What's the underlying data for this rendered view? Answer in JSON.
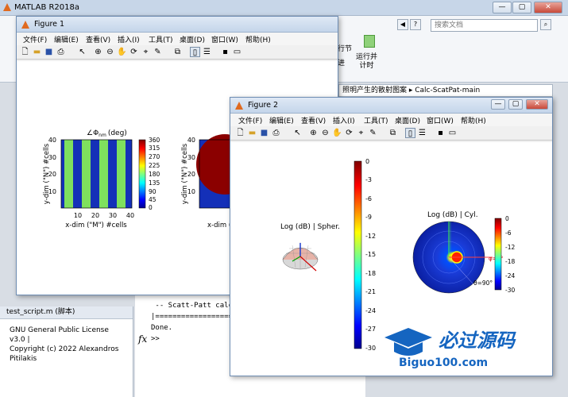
{
  "main_window": {
    "title": "MATLAB R2018a",
    "controls": [
      "—",
      "▢",
      "✕"
    ],
    "search_placeholder": "搜索文档",
    "ribbon_labels": [
      "行节",
      "运行并\n计时"
    ],
    "ribbon_fragment": "进",
    "address": "照明产生的散射图案 ▸ Calc-ScatPat-main"
  },
  "left_panel": {
    "file_tab": "test_script.m  (脚本)",
    "text_lines": [
      "GNU General Public License v3.0 |",
      "Copyright (c) 2022 Alexandros",
      "Pitilakis"
    ]
  },
  "command_window": {
    "lines": [
      " -- Scatt-Patt calc.",
      "|==========================",
      "Done."
    ],
    "prompt": ">>",
    "fx": "fx"
  },
  "figure1": {
    "title": "Figure 1",
    "menu": [
      "文件(F)",
      "编辑(E)",
      "查看(V)",
      "插入(I)",
      "工具(T)",
      "桌面(D)",
      "窗口(W)",
      "帮助(H)"
    ],
    "plot_title": "∠Φ",
    "plot_title_sub": "nm",
    "plot_title_unit": "(deg)",
    "xlabel": "x-dim (\"M\") #cells",
    "ylabel": "y-dim (\"N\") #cells",
    "xticks": [
      "10",
      "20",
      "30",
      "40"
    ],
    "yticks": [
      "40",
      "30",
      "20",
      "10"
    ],
    "colorbar_ticks": [
      "360",
      "315",
      "270",
      "225",
      "180",
      "135",
      "90",
      "45",
      "0"
    ],
    "xlabel2": "x-dim (\"M",
    "ylabel2": "y-dim (\"N\") #cells",
    "yticks2": [
      "40",
      "30",
      "20",
      "10"
    ]
  },
  "figure2": {
    "title": "Figure 2",
    "menu": [
      "文件(F)",
      "编辑(E)",
      "查看(V)",
      "插入(I)",
      "工具(T)",
      "桌面(D)",
      "窗口(W)",
      "帮助(H)"
    ],
    "left_title": "Log (dB) | Spher.",
    "right_title": "Log (dB) | Cyl.",
    "main_colorbar_ticks": [
      "0",
      "-3",
      "-6",
      "-9",
      "-12",
      "-15",
      "-18",
      "-21",
      "-24",
      "-27",
      "-30"
    ],
    "small_colorbar_ticks": [
      "0",
      "-6",
      "-12",
      "-18",
      "-24",
      "-30"
    ],
    "theta_label": "θ=90°",
    "phi_label": "φ=0°"
  },
  "watermark": {
    "text": "必过源码",
    "url": "Biguo100.com"
  },
  "colors": {
    "accent": "#0f63c6",
    "stripe_green": "#7fe05e",
    "stripe_blue": "#1430b8",
    "dark_red": "#8b0000"
  }
}
